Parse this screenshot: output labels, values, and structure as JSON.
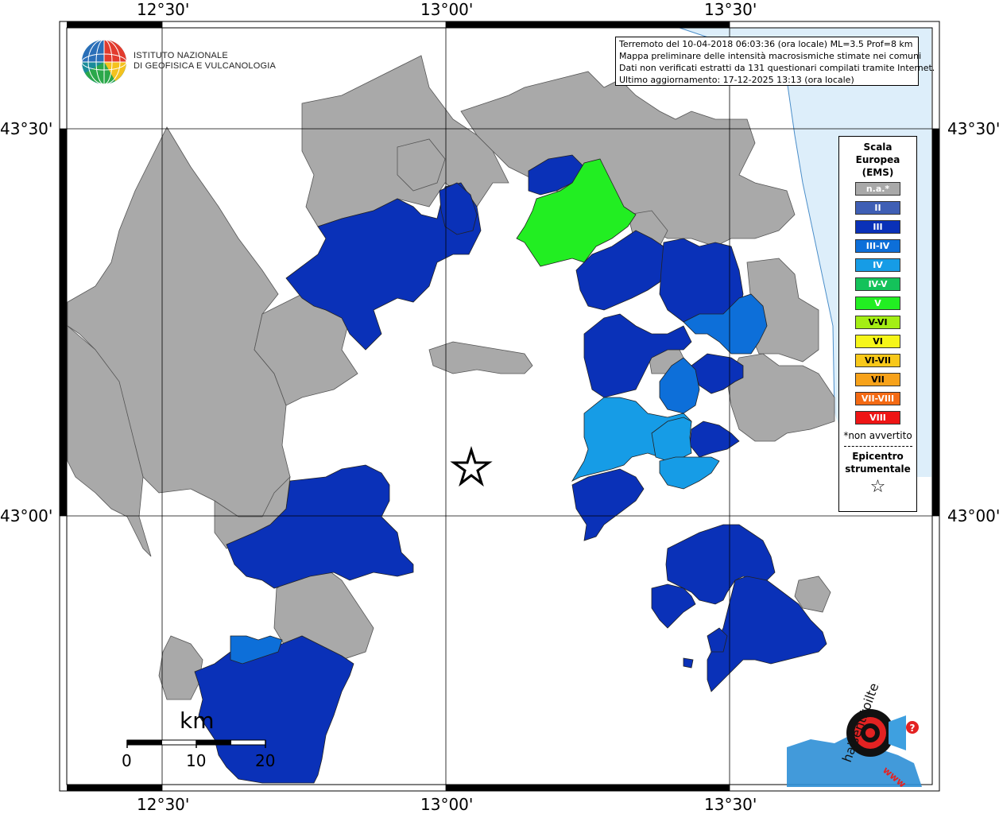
{
  "header": {
    "org_line1": "ISTITUTO NAZIONALE",
    "org_line2": "DI GEOFISICA E VULCANOLOGIA"
  },
  "info": {
    "line1": "Terremoto del 10-04-2018 06:03:36 (ora locale) ML=3.5 Prof=8 km",
    "line2": "Mappa preliminare delle intensità macrosismiche stimate nei comuni",
    "line3": "Dati non verificati estratti da 131 questionari compilati tramite Internet.",
    "line4": "Ultimo aggiornamento: 17-12-2025 13:13 (ora locale)"
  },
  "axes": {
    "top": [
      "12°30'",
      "13°00'",
      "13°30'"
    ],
    "bottom": [
      "12°30'",
      "13°00'",
      "13°30'"
    ],
    "left": [
      "43°30'",
      "43°00'"
    ],
    "right": [
      "43°30'",
      "43°00'"
    ]
  },
  "legend": {
    "title_line1": "Scala",
    "title_line2": "Europea",
    "title_line3": "(EMS)",
    "items": [
      {
        "label": "n.a.*",
        "color": "#a9a9a9"
      },
      {
        "label": "II",
        "color": "#3f5fb5"
      },
      {
        "label": "III",
        "color": "#0a31b8"
      },
      {
        "label": "III-IV",
        "color": "#0d6fd9"
      },
      {
        "label": "IV",
        "color": "#169ce6"
      },
      {
        "label": "IV-V",
        "color": "#14c25a"
      },
      {
        "label": "V",
        "color": "#22ee22"
      },
      {
        "label": "V-VI",
        "color": "#a4ee14"
      },
      {
        "label": "VI",
        "color": "#f6f619"
      },
      {
        "label": "VI-VII",
        "color": "#f8c81a"
      },
      {
        "label": "VII",
        "color": "#f7a21a"
      },
      {
        "label": "VII-VIII",
        "color": "#f46a14"
      },
      {
        "label": "VIII",
        "color": "#ee1515"
      }
    ],
    "note": "*non avvertito",
    "epicenter_line1": "Epicentro",
    "epicenter_line2": "strumentale",
    "epicenter_symbol": "☆"
  },
  "scale_bar": {
    "unit": "km",
    "ticks": [
      "0",
      "10",
      "20"
    ]
  },
  "watermark": {
    "text": "haisentitoilterremoto.it",
    "prefix": "www.",
    "question": "?"
  },
  "colors": {
    "sea": "#ddeefa",
    "na": "#a9a9a9",
    "III": "#0a31b8",
    "III_IV": "#0d6fd9",
    "IV": "#169ce6",
    "V": "#22ee22"
  }
}
